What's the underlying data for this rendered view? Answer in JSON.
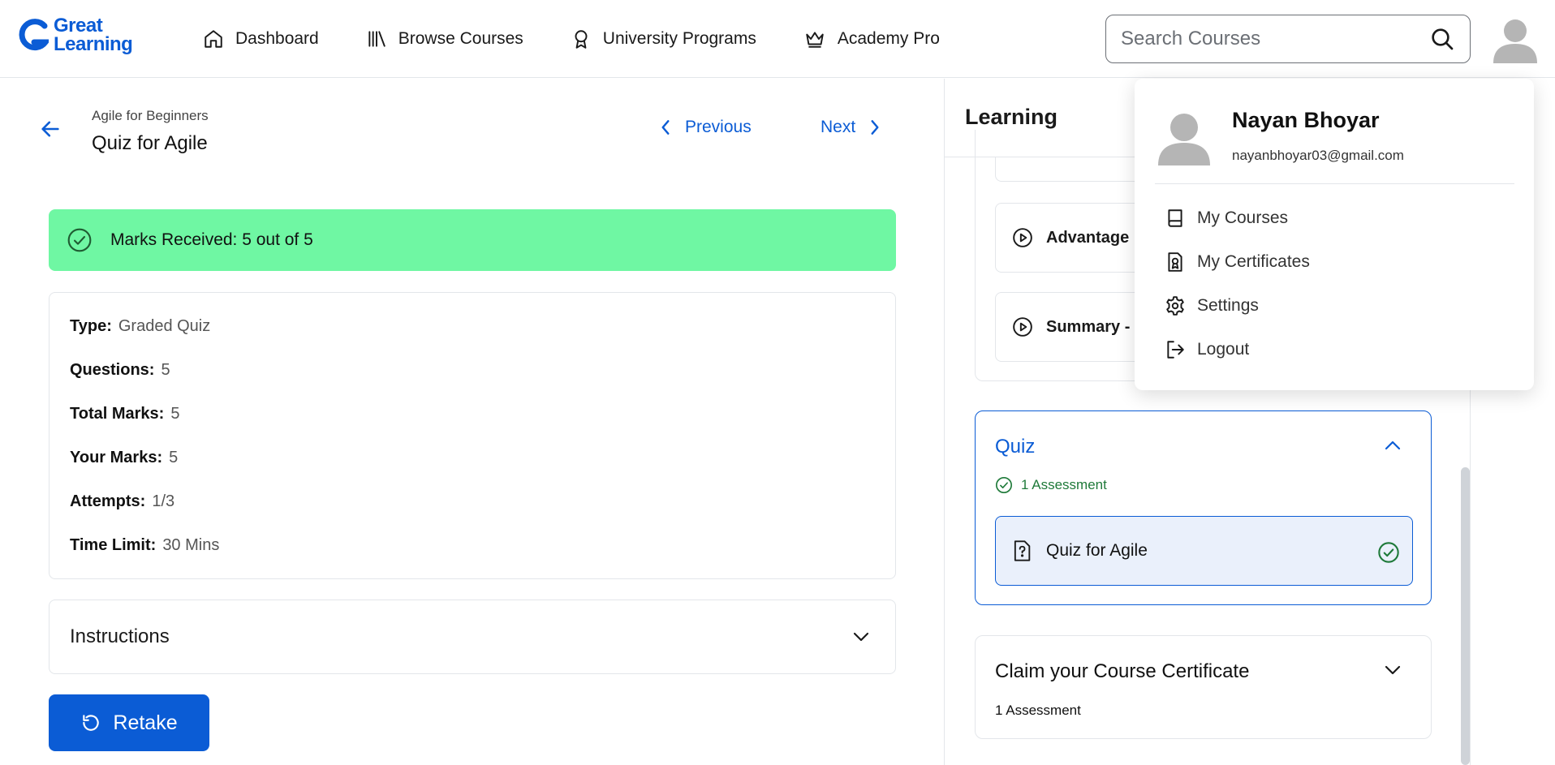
{
  "header": {
    "logo_line1": "Great",
    "logo_line2": "Learning",
    "nav": [
      {
        "label": "Dashboard",
        "icon": "home-icon"
      },
      {
        "label": "Browse Courses",
        "icon": "library-icon"
      },
      {
        "label": "University Programs",
        "icon": "award-icon"
      },
      {
        "label": "Academy Pro",
        "icon": "crown-icon"
      }
    ],
    "search_placeholder": "Search Courses"
  },
  "page": {
    "breadcrumb": "Agile for Beginners",
    "title": "Quiz for Agile",
    "prev_label": "Previous",
    "next_label": "Next"
  },
  "result": {
    "banner": "Marks Received: 5 out of 5",
    "color": "#6ff7a3"
  },
  "quiz_info": [
    {
      "key": "Type:",
      "value": "Graded Quiz"
    },
    {
      "key": "Questions:",
      "value": "5"
    },
    {
      "key": "Total Marks:",
      "value": "5"
    },
    {
      "key": "Your Marks:",
      "value": "5"
    },
    {
      "key": "Attempts:",
      "value": "1/3"
    },
    {
      "key": "Time Limit:",
      "value": "30 Mins"
    }
  ],
  "instructions_label": "Instructions",
  "retake_label": "Retake",
  "sidebar": {
    "title": "Learning",
    "lessons": [
      {
        "label": "Advantage"
      },
      {
        "label": "Summary -"
      }
    ],
    "quiz_section": {
      "title": "Quiz",
      "count": "1 Assessment",
      "item": "Quiz for Agile"
    },
    "cert_section": {
      "title": "Claim your Course Certificate",
      "count": "1 Assessment"
    }
  },
  "user_menu": {
    "name": "Nayan Bhoyar",
    "email": "nayanbhoyar03@gmail.com",
    "items": [
      {
        "label": "My Courses",
        "icon": "book-icon"
      },
      {
        "label": "My Certificates",
        "icon": "certificate-icon"
      },
      {
        "label": "Settings",
        "icon": "gear-icon"
      },
      {
        "label": "Logout",
        "icon": "logout-icon"
      }
    ]
  },
  "colors": {
    "accent": "#0b5cd5",
    "success": "#1f7a3a",
    "selected_bg": "#eaf0fb"
  }
}
